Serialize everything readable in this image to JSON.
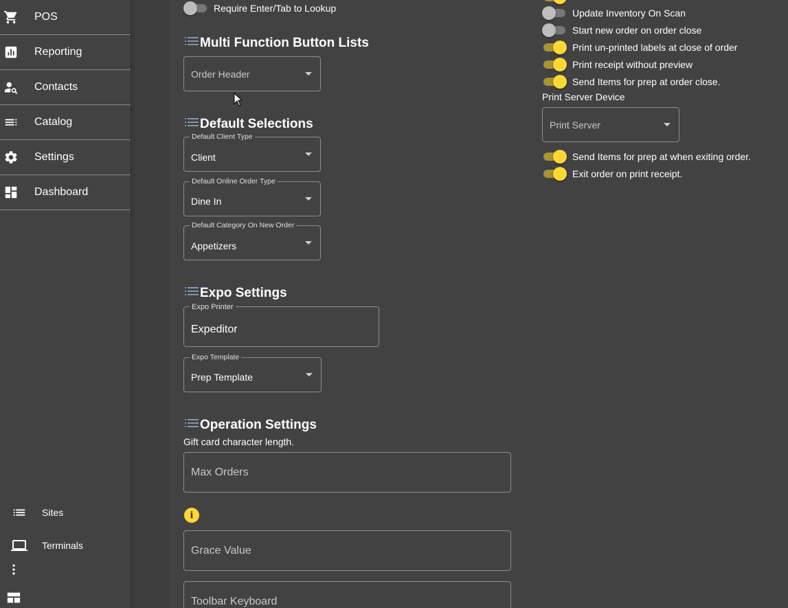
{
  "sidebar": {
    "items": [
      {
        "label": "POS",
        "icon": "cart-icon"
      },
      {
        "label": "Reporting",
        "icon": "report-icon"
      },
      {
        "label": "Contacts",
        "icon": "contact-search-icon"
      },
      {
        "label": "Catalog",
        "icon": "list-icon"
      },
      {
        "label": "Settings",
        "icon": "gear-icon"
      },
      {
        "label": "Dashboard",
        "icon": "dashboard-icon"
      }
    ],
    "bottom": [
      {
        "label": "Sites",
        "icon": "list-icon"
      },
      {
        "label": "Terminals",
        "icon": "laptop-icon"
      }
    ]
  },
  "left": {
    "require_enter_label": "Require Enter/Tab to Lookup",
    "multi_function": {
      "heading": "Multi Function Button Lists",
      "select_value": "Order Header"
    },
    "default_selections": {
      "heading": "Default Selections",
      "client_type_label": "Default Client Type",
      "client_type_value": "Client",
      "online_order_label": "Default Online Order Type",
      "online_order_value": "Dine In",
      "category_label": "Default Category On New Order",
      "category_value": "Appetizers"
    },
    "expo": {
      "heading": "Expo Settings",
      "printer_label": "Expo Printer",
      "printer_value": "Expeditor",
      "template_label": "Expo Template",
      "template_value": "Prep Template"
    },
    "operation": {
      "heading": "Operation Settings",
      "gift_card_label": "Gift card character length.",
      "max_orders_placeholder": "Max Orders",
      "grace_value_placeholder": "Grace Value",
      "toolbar_keyboard_placeholder": "Toolbar Keyboard"
    }
  },
  "right": {
    "toggles_top": [
      {
        "label": "Update Inventory On Scan",
        "on": false
      },
      {
        "label": "Start new order on order close",
        "on": false
      },
      {
        "label": "Print un-printed labels at close of order",
        "on": true
      },
      {
        "label": "Print receipt without preview",
        "on": true
      },
      {
        "label": "Send Items for prep at order close.",
        "on": true
      }
    ],
    "print_server_label": "Print Server Device",
    "print_server_placeholder": "Print Server",
    "toggles_bottom": [
      {
        "label": "Send Items for prep at when exiting order.",
        "on": true
      },
      {
        "label": "Exit order on print receipt.",
        "on": true
      }
    ]
  },
  "colors": {
    "background": "#424242",
    "accent": "#fdd835",
    "accent_track": "#a89434",
    "heading_icon": "#8fa8c8"
  }
}
